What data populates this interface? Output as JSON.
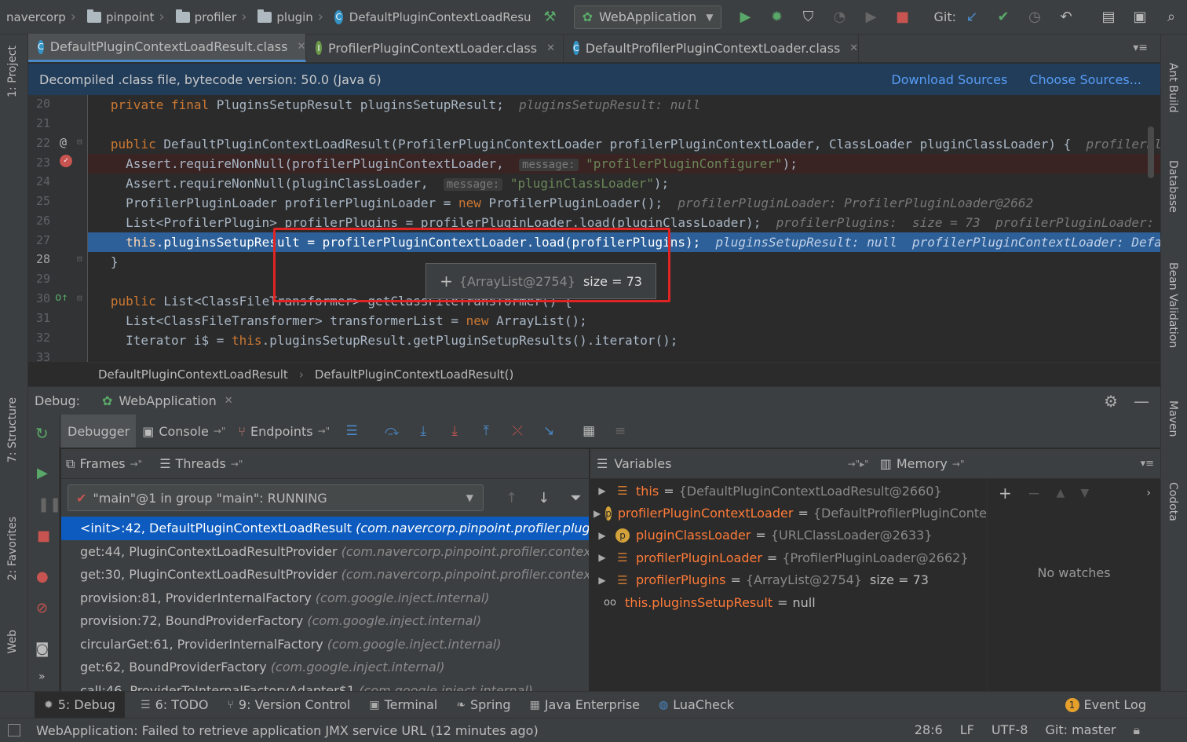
{
  "toolbar": {
    "breadcrumbs": [
      "navercorp",
      "pinpoint",
      "profiler",
      "plugin",
      "DefaultPluginContextLoadResu"
    ],
    "run_config": "WebApplication",
    "git_label": "Git:"
  },
  "tabs": [
    {
      "label": "DefaultPluginContextLoadResult.class",
      "icon": "C"
    },
    {
      "label": "ProfilerPluginContextLoader.class",
      "icon": "I"
    },
    {
      "label": "DefaultProfilerPluginContextLoader.class",
      "icon": "C"
    }
  ],
  "banner": {
    "text": "Decompiled .class file, bytecode version: 50.0 (Java 6)",
    "download": "Download Sources",
    "choose": "Choose Sources..."
  },
  "left_tools": [
    "1: Project",
    "7: Structure",
    "2: Favorites",
    "Web"
  ],
  "right_tools": [
    "Ant Build",
    "Database",
    "Bean Validation",
    "Maven",
    "Codota"
  ],
  "editor": {
    "line_numbers": [
      "20",
      "21",
      "22",
      "23",
      "24",
      "25",
      "26",
      "27",
      "28",
      "29",
      "30",
      "31",
      "32",
      "33"
    ],
    "tooltip_object": "{ArrayList@2754}",
    "tooltip_size": "size = 73"
  },
  "code_breadcrumb": [
    "DefaultPluginContextLoadResult",
    "DefaultPluginContextLoadResult()"
  ],
  "debug": {
    "label": "Debug:",
    "session": "WebApplication",
    "tabs": [
      "Debugger",
      "Console",
      "Endpoints"
    ],
    "frames_label": "Frames",
    "threads_label": "Threads",
    "thread_selected": "\"main\"@1 in group \"main\": RUNNING",
    "frames": [
      {
        "method": "<init>:42, DefaultPluginContextLoadResult",
        "pkg": "(com.navercorp.pinpoint.profiler.plugin)"
      },
      {
        "method": "get:44, PluginContextLoadResultProvider",
        "pkg": "(com.navercorp.pinpoint.profiler.context.pr"
      },
      {
        "method": "get:30, PluginContextLoadResultProvider",
        "pkg": "(com.navercorp.pinpoint.profiler.context.pr"
      },
      {
        "method": "provision:81, ProviderInternalFactory",
        "pkg": "(com.google.inject.internal)"
      },
      {
        "method": "provision:72, BoundProviderFactory",
        "pkg": "(com.google.inject.internal)"
      },
      {
        "method": "circularGet:61, ProviderInternalFactory",
        "pkg": "(com.google.inject.internal)"
      },
      {
        "method": "get:62, BoundProviderFactory",
        "pkg": "(com.google.inject.internal)"
      },
      {
        "method": "call:46, ProviderToInternalFactoryAdapter$1",
        "pkg": "(com.google.inject.internal)"
      }
    ],
    "variables_label": "Variables",
    "memory_label": "Memory",
    "variables": [
      {
        "name": "this",
        "value": "{DefaultPluginContextLoadResult@2660}",
        "extra": "",
        "icon": "field"
      },
      {
        "name": "profilerPluginContextLoader",
        "value": "{DefaultProfilerPluginConte:",
        "extra": "",
        "icon": "p"
      },
      {
        "name": "pluginClassLoader",
        "value": "{URLClassLoader@2633}",
        "extra": "",
        "icon": "p"
      },
      {
        "name": "profilerPluginLoader",
        "value": "{ProfilerPluginLoader@2662}",
        "extra": "",
        "icon": "field"
      },
      {
        "name": "profilerPlugins",
        "value": "{ArrayList@2754}",
        "extra": "size = 73",
        "icon": "field"
      },
      {
        "name": "this.pluginsSetupResult",
        "value": "null",
        "extra": "",
        "icon": "oo"
      }
    ],
    "no_watches": "No watches"
  },
  "bottom_tabs": [
    "5: Debug",
    "6: TODO",
    "9: Version Control",
    "Terminal",
    "Spring",
    "Java Enterprise",
    "LuaCheck"
  ],
  "event_log": "Event Log",
  "event_count": "1",
  "status": {
    "message": "WebApplication: Failed to retrieve application JMX service URL (12 minutes ago)",
    "position": "28:6",
    "line_sep": "LF",
    "encoding": "UTF-8",
    "git": "Git: master"
  },
  "colors": {
    "accent": "#4a88c7",
    "selection": "#0d5bbf",
    "highlight": "#2d6099",
    "callout": "#e02424"
  }
}
